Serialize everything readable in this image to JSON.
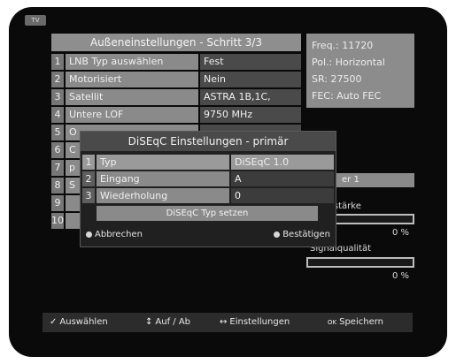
{
  "screen": {
    "tv_badge": "TV"
  },
  "panel": {
    "title": "Außeneinstellungen - Schritt 3/3",
    "rows": [
      {
        "num": "1",
        "label": "LNB Typ auswählen",
        "value": "Fest"
      },
      {
        "num": "2",
        "label": "Motorisiert",
        "value": "Nein"
      },
      {
        "num": "3",
        "label": "Satellit",
        "value": "ASTRA 1B,1C,"
      },
      {
        "num": "4",
        "label": "Untere LOF",
        "value": "9750 MHz"
      },
      {
        "num": "5",
        "label": "O",
        "value": ""
      },
      {
        "num": "6",
        "label": "C",
        "value": ""
      },
      {
        "num": "7",
        "label": "p",
        "value": ""
      },
      {
        "num": "8",
        "label": "S",
        "value": ""
      },
      {
        "num": "9",
        "label": "",
        "value": ""
      },
      {
        "num": "10",
        "label": "",
        "value": ""
      }
    ]
  },
  "info": {
    "freq": "Freq.: 11720",
    "pol": "Pol.: Horizontal",
    "sr": "SR: 27500",
    "fec": "FEC: Auto FEC"
  },
  "right": {
    "item_value": "er 1",
    "strength_label": "alstärke",
    "strength_percent": "0 %",
    "quality_label": "Signalqualität",
    "quality_percent": "0 %"
  },
  "dialog": {
    "title": "DiSEqC Einstellungen - primär",
    "rows": [
      {
        "num": "1",
        "label": "Typ",
        "value": "DiSEqC 1.0"
      },
      {
        "num": "2",
        "label": "Eingang",
        "value": "A"
      },
      {
        "num": "3",
        "label": "Wiederholung",
        "value": "0"
      }
    ],
    "action_label": "DiSEqC Typ setzen",
    "cancel_label": "Abbrechen",
    "confirm_label": "Bestätigen"
  },
  "footer": {
    "select_label": "Auswählen",
    "updown_label": "Auf / Ab",
    "settings_label": "Einstellungen",
    "save_label": "Speichern"
  }
}
